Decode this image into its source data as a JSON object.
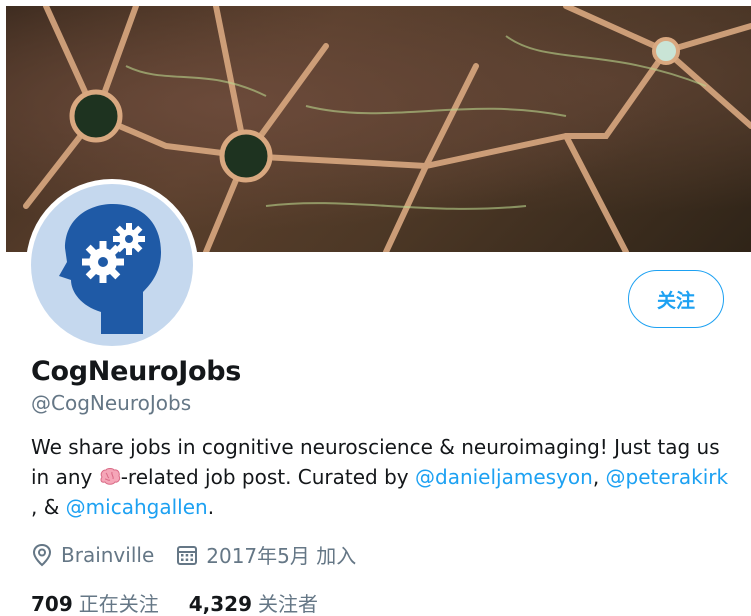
{
  "profile": {
    "name": "CogNeuroJobs",
    "handle": "@CogNeuroJobs",
    "follow_label": "关注",
    "bio": {
      "part1": "We share jobs in cognitive neuroscience & neuroimaging! Just tag us in any ",
      "emoji": "brain",
      "part2": "-related job post. Curated by ",
      "link1": "@danieljamesyon",
      "sep1": ", ",
      "link2": "@peterakirk",
      "sep2": " , & ",
      "link3": "@micahgallen",
      "end": "."
    },
    "location": "Brainville",
    "joined": "2017年5月 加入",
    "following_count": "709",
    "following_label": "正在关注",
    "followers_count": "4,329",
    "followers_label": "关注者"
  },
  "icons": {
    "location": "location-pin-icon",
    "calendar": "calendar-icon",
    "avatar": "head-gears-icon"
  },
  "colors": {
    "accent": "#1da1f2",
    "text": "#14171a",
    "muted": "#657786",
    "avatar_bg": "#c5d8ee",
    "avatar_head": "#1f5aa6"
  }
}
